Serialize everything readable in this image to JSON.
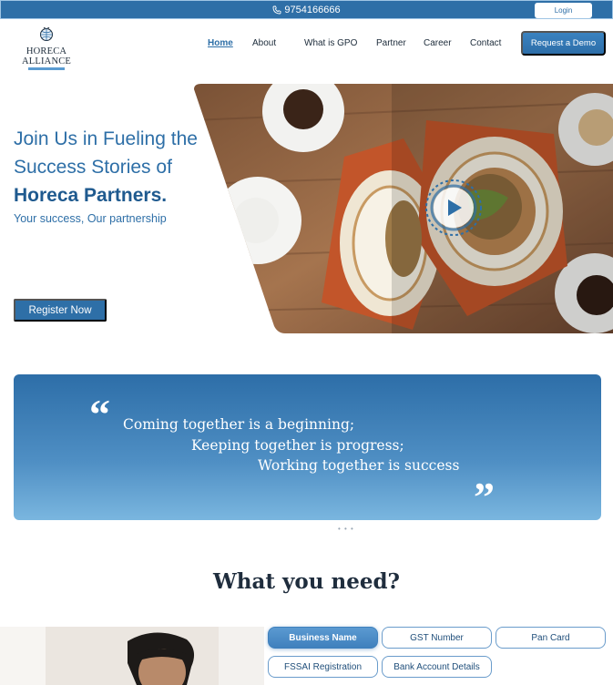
{
  "topbar": {
    "phone": "9754166666",
    "login_label": "Login"
  },
  "logo": {
    "line1": "HORECA",
    "line2": "ALLIANCE"
  },
  "nav": {
    "items": [
      "Home",
      "About",
      "What is GPO",
      "Partner",
      "Career",
      "Contact"
    ],
    "demo_label": "Request a Demo"
  },
  "hero": {
    "line1": "Join Us in Fueling the",
    "line2": "Success Stories of",
    "line3": "Horeca Partners.",
    "subtitle": "Your success, Our partnership",
    "register_label": "Register Now"
  },
  "quote": {
    "open_mark": "“",
    "close_mark": "”",
    "line1": "Coming together is a beginning;",
    "line2": "Keeping together is progress;",
    "line3": "Working together is success"
  },
  "need": {
    "title": "What you need?",
    "tags": [
      "Business Name",
      "GST Number",
      "Pan Card",
      "FSSAI Registration",
      "Bank Account Details"
    ]
  },
  "colors": {
    "accent": "#2e6fa7",
    "banner_light": "#7ab6df"
  }
}
